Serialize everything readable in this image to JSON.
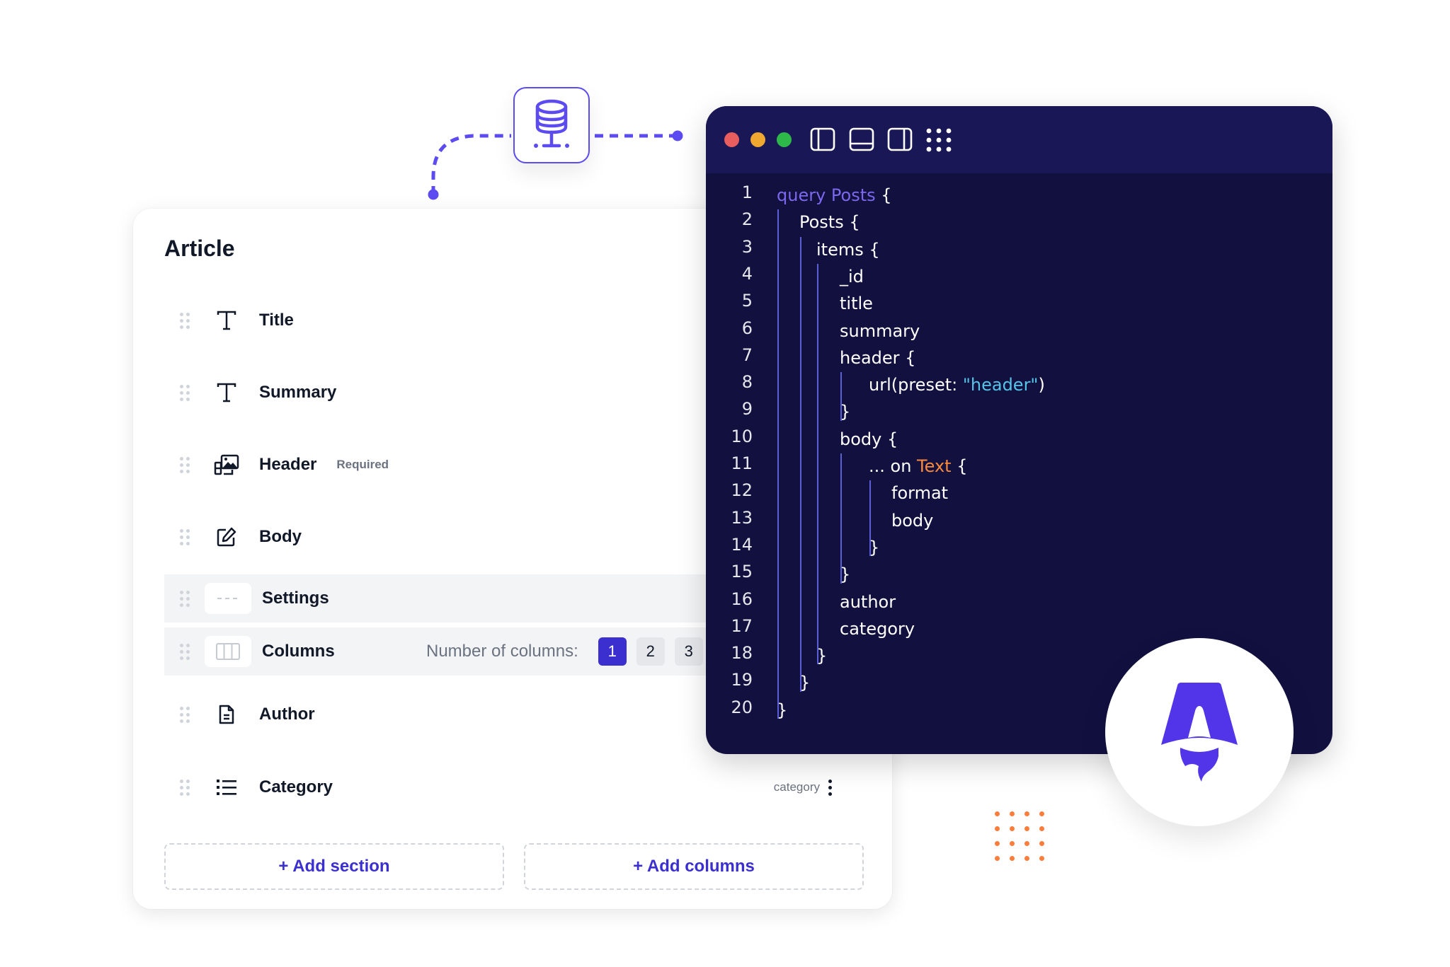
{
  "colors": {
    "accent": "#5b4bf0",
    "accent_dark": "#3b2fd0",
    "editor_bg": "#12103f",
    "editor_header_bg": "#1a1756",
    "orange": "#fb7d3c",
    "traffic_red": "#e85d5d",
    "traffic_yellow": "#f0a830",
    "traffic_green": "#2fb84a"
  },
  "connector": {
    "icon": "database-network-icon"
  },
  "article_panel": {
    "title": "Article",
    "fields": [
      {
        "label": "Title",
        "icon": "text-type-icon"
      },
      {
        "label": "Summary",
        "icon": "text-type-icon"
      },
      {
        "label": "Header",
        "icon": "image-gallery-icon",
        "badge": "Required"
      },
      {
        "label": "Body",
        "icon": "edit-pencil-icon"
      },
      {
        "label": "Settings",
        "icon": "divider-dashes-icon"
      },
      {
        "label": "Columns",
        "icon": "columns-layout-icon",
        "columns_label": "Number of columns:",
        "column_options": [
          "1",
          "2",
          "3"
        ],
        "selected_columns": "1"
      },
      {
        "label": "Author",
        "icon": "document-icon"
      },
      {
        "label": "Category",
        "icon": "list-icon",
        "tag": "category"
      }
    ],
    "add_section_label": "+ Add section",
    "add_columns_label": "+ Add columns"
  },
  "editor": {
    "toolbar_icons": [
      "sidebar-left-icon",
      "panel-bottom-icon",
      "sidebar-right-icon",
      "grid-dots-icon"
    ],
    "lines": [
      {
        "n": "1",
        "indent": 0,
        "parts": [
          {
            "t": "query Posts",
            "c": "kw"
          },
          {
            "t": " {",
            "c": ""
          }
        ]
      },
      {
        "n": "2",
        "indent": 1,
        "parts": [
          {
            "t": "Posts {",
            "c": ""
          }
        ]
      },
      {
        "n": "3",
        "indent": 2,
        "parts": [
          {
            "t": "items {",
            "c": ""
          }
        ]
      },
      {
        "n": "4",
        "indent": 3,
        "parts": [
          {
            "t": "_id",
            "c": ""
          }
        ]
      },
      {
        "n": "5",
        "indent": 3,
        "parts": [
          {
            "t": "title",
            "c": ""
          }
        ]
      },
      {
        "n": "6",
        "indent": 3,
        "parts": [
          {
            "t": "summary",
            "c": ""
          }
        ]
      },
      {
        "n": "7",
        "indent": 3,
        "parts": [
          {
            "t": "header {",
            "c": ""
          }
        ]
      },
      {
        "n": "8",
        "indent": 4,
        "parts": [
          {
            "t": "url(preset: ",
            "c": ""
          },
          {
            "t": "\"header\"",
            "c": "str"
          },
          {
            "t": ")",
            "c": ""
          }
        ]
      },
      {
        "n": "9",
        "indent": 3,
        "parts": [
          {
            "t": "}",
            "c": ""
          }
        ]
      },
      {
        "n": "10",
        "indent": 3,
        "parts": [
          {
            "t": "body {",
            "c": ""
          }
        ]
      },
      {
        "n": "11",
        "indent": 4,
        "parts": [
          {
            "t": "... on ",
            "c": ""
          },
          {
            "t": "Text",
            "c": "type"
          },
          {
            "t": " {",
            "c": ""
          }
        ]
      },
      {
        "n": "12",
        "indent": 5,
        "parts": [
          {
            "t": "format",
            "c": ""
          }
        ]
      },
      {
        "n": "13",
        "indent": 5,
        "parts": [
          {
            "t": "body",
            "c": ""
          }
        ]
      },
      {
        "n": "14",
        "indent": 4,
        "parts": [
          {
            "t": "}",
            "c": ""
          }
        ]
      },
      {
        "n": "15",
        "indent": 3,
        "parts": [
          {
            "t": "}",
            "c": ""
          }
        ]
      },
      {
        "n": "16",
        "indent": 3,
        "parts": [
          {
            "t": "author",
            "c": ""
          }
        ]
      },
      {
        "n": "17",
        "indent": 3,
        "parts": [
          {
            "t": "category",
            "c": ""
          }
        ]
      },
      {
        "n": "18",
        "indent": 2,
        "parts": [
          {
            "t": "}",
            "c": ""
          }
        ]
      },
      {
        "n": "19",
        "indent": 1,
        "parts": [
          {
            "t": "}",
            "c": ""
          }
        ]
      },
      {
        "n": "20",
        "indent": 0,
        "parts": [
          {
            "t": "}",
            "c": ""
          }
        ]
      }
    ]
  },
  "badge": {
    "icon": "astro-logo-icon"
  }
}
